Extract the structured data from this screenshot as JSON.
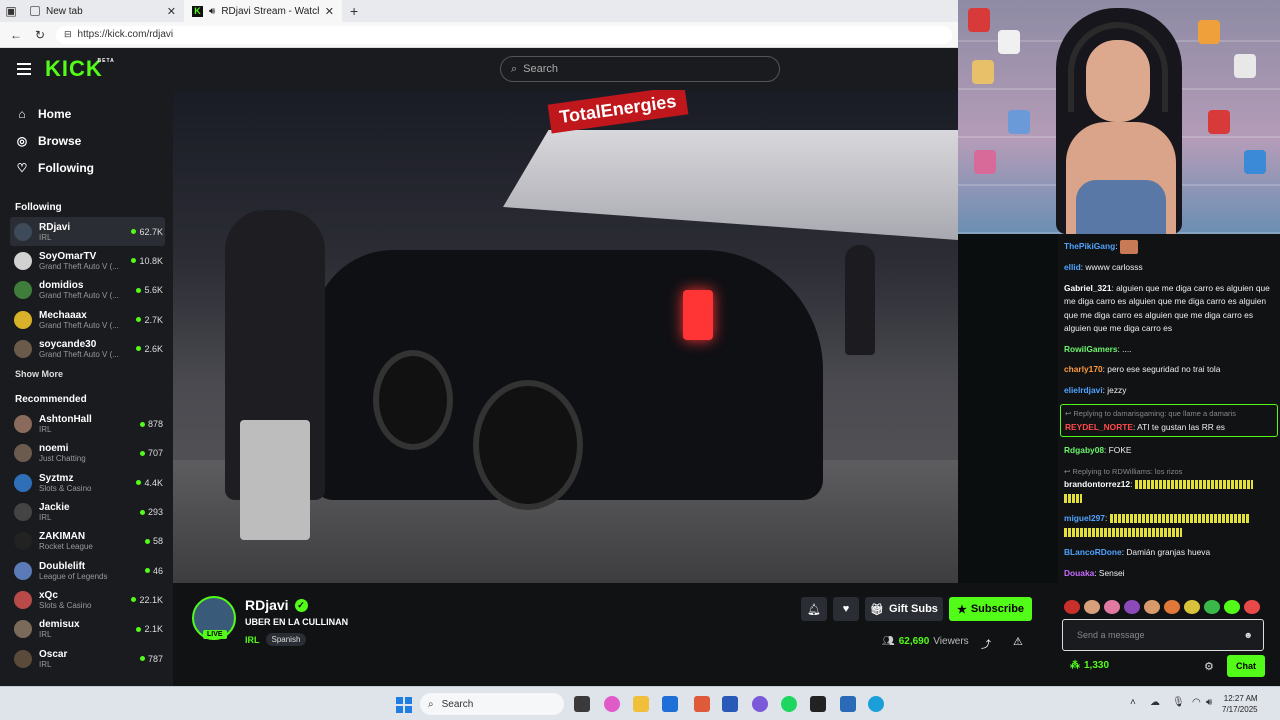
{
  "browser": {
    "tabs": [
      {
        "title": "New tab"
      },
      {
        "title": "RDjavi Stream - Watch Live o"
      }
    ],
    "url": "https://kick.com/rdjavi"
  },
  "header": {
    "logo": "KICK",
    "logo_badge": "BETA",
    "search_placeholder": "Search"
  },
  "sidebar": {
    "nav": [
      {
        "label": "Home",
        "icon": "home-icon"
      },
      {
        "label": "Browse",
        "icon": "compass-icon"
      },
      {
        "label": "Following",
        "icon": "heart-icon"
      }
    ],
    "following_title": "Following",
    "following": [
      {
        "name": "RDjavi",
        "category": "IRL",
        "viewers": "62.7K",
        "color": "#3c4a5a"
      },
      {
        "name": "SoyOmarTV",
        "category": "Grand Theft Auto V (...",
        "viewers": "10.8K",
        "color": "#d1d1d1"
      },
      {
        "name": "domidios",
        "category": "Grand Theft Auto V (...",
        "viewers": "5.6K",
        "color": "#3f7d3a"
      },
      {
        "name": "Mechaaax",
        "category": "Grand Theft Auto V (...",
        "viewers": "2.7K",
        "color": "#d8b22a"
      },
      {
        "name": "soycande30",
        "category": "Grand Theft Auto V (...",
        "viewers": "2.6K",
        "color": "#6a5a4a"
      }
    ],
    "show_more": "Show More",
    "recommended_title": "Recommended",
    "recommended": [
      {
        "name": "AshtonHall",
        "category": "IRL",
        "viewers": "878",
        "color": "#8a6a5a"
      },
      {
        "name": "noemi",
        "category": "Just Chatting",
        "viewers": "707",
        "color": "#6b5a4e"
      },
      {
        "name": "Syztmz",
        "category": "Slots & Casino",
        "viewers": "4.4K",
        "color": "#2f6fb8"
      },
      {
        "name": "Jackie",
        "category": "IRL",
        "viewers": "293",
        "color": "#444"
      },
      {
        "name": "ZAKIMAN",
        "category": "Rocket League",
        "viewers": "58",
        "color": "#222"
      },
      {
        "name": "Doublelift",
        "category": "League of Legends",
        "viewers": "46",
        "color": "#5a7ab8"
      },
      {
        "name": "xQc",
        "category": "Slots & Casino",
        "viewers": "22.1K",
        "color": "#b84a4a"
      },
      {
        "name": "demisux",
        "category": "IRL",
        "viewers": "2.1K",
        "color": "#7a6a5a"
      },
      {
        "name": "Oscar",
        "category": "IRL",
        "viewers": "787",
        "color": "#5a4a3a"
      }
    ]
  },
  "video": {
    "sign_text": "TotalEnergies"
  },
  "stream": {
    "streamer": "RDjavi",
    "live_label": "LIVE",
    "title": "UBER EN LA CULLINAN",
    "category": "IRL",
    "language": "Spanish",
    "gift_label": "Gift Subs",
    "subscribe_label": "Subscribe",
    "viewer_count": "62,690",
    "viewer_label": "Viewers"
  },
  "chat": {
    "messages": [
      {
        "user": "ThePikiGang",
        "color": "#4fa3ff",
        "text": "",
        "emote": true
      },
      {
        "user": "ellid",
        "color": "#4fa3ff",
        "text": ": wwww carlosss"
      },
      {
        "user": "Gabriel_321",
        "color": "#ffffff",
        "text": ": alguien que me diga carro es alguien que me diga carro es alguien que me diga carro es alguien que me diga carro es alguien que me diga carro es alguien que me diga carro es"
      },
      {
        "user": "RowilGamers",
        "color": "#6cf56c",
        "text": ": ...."
      },
      {
        "user": "charly170",
        "color": "#ff9a3c",
        "text": ": pero ese seguridad no trai tola"
      },
      {
        "user": "elielrdjavi",
        "color": "#4fa3ff",
        "text": ": jezzy"
      }
    ],
    "reply1": {
      "reply_to": "Replying to damarisgaming: que llame a damaris",
      "user": "REYDEL_NORTE",
      "text": ": ATI te gustan las RR es"
    },
    "msg_after_reply": {
      "user": "Rdgaby08",
      "text": ": FOKE"
    },
    "reply2": {
      "reply_to": "Replying to RDWilliams: los rizos",
      "user": "brandontorrez12",
      "text": ":"
    },
    "msg_miguel": {
      "user": "miguel297",
      "text": ":"
    },
    "msg_blanco": {
      "user": "BLancoRDone",
      "text": ": Damián granjas hueva"
    },
    "msg_douaka": {
      "user": "Douaka",
      "text": ": Sensei"
    },
    "input_placeholder": "Send a message",
    "points": "1,330",
    "chat_button": "Chat"
  },
  "taskbar": {
    "search_label": "Search",
    "time": "12:27 AM",
    "date": "7/17/2025"
  }
}
